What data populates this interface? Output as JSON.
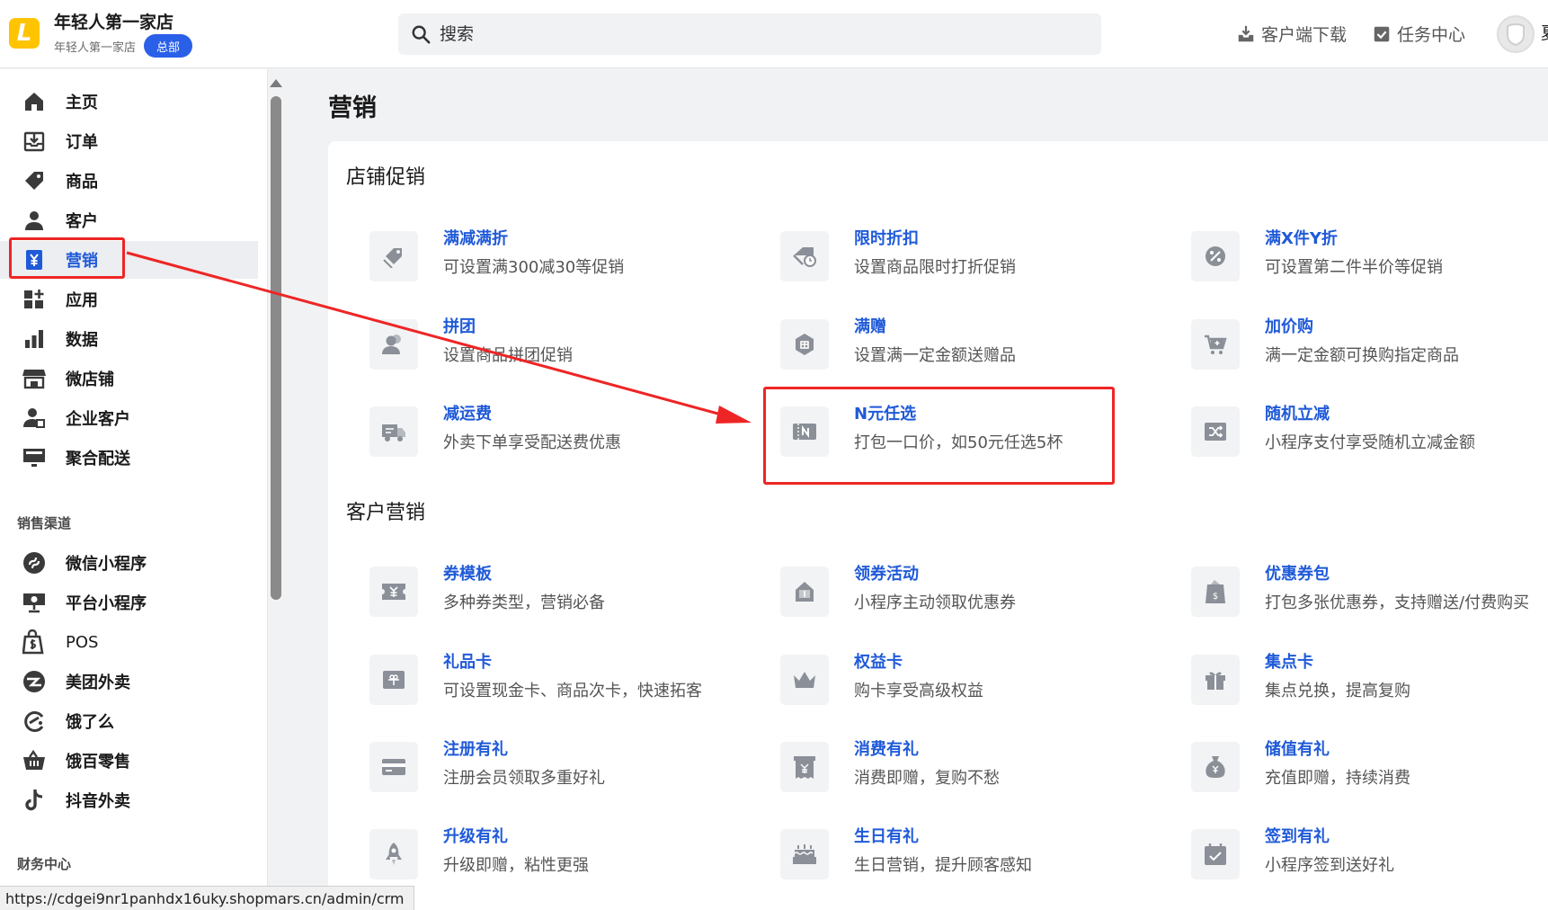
{
  "header": {
    "logo_glyph": "L",
    "store_name": "年轻人第一家店",
    "store_sub": "年轻人第一家店",
    "badge": "总部",
    "search_placeholder": "搜索",
    "client_download": "客户端下载",
    "task_center": "任务中心",
    "cut_text": "夏"
  },
  "sidebar": {
    "main_items": [
      {
        "label": "主页",
        "icon": "home-icon"
      },
      {
        "label": "订单",
        "icon": "order-icon"
      },
      {
        "label": "商品",
        "icon": "tag-icon"
      },
      {
        "label": "客户",
        "icon": "user-icon"
      },
      {
        "label": "营销",
        "icon": "yen-icon",
        "active": true
      },
      {
        "label": "应用",
        "icon": "apps-icon"
      },
      {
        "label": "数据",
        "icon": "bar-chart-icon"
      },
      {
        "label": "微店铺",
        "icon": "store-icon"
      },
      {
        "label": "企业客户",
        "icon": "enterprise-user-icon"
      },
      {
        "label": "聚合配送",
        "icon": "monitor-icon"
      }
    ],
    "channel_title": "销售渠道",
    "channel_items": [
      {
        "label": "微信小程序",
        "icon": "mini-program-icon"
      },
      {
        "label": "平台小程序",
        "icon": "platform-icon"
      },
      {
        "label": "POS",
        "icon": "pos-bag-icon"
      },
      {
        "label": "美团外卖",
        "icon": "meituan-icon"
      },
      {
        "label": "饿了么",
        "icon": "eleme-icon"
      },
      {
        "label": "饿百零售",
        "icon": "basket-icon"
      },
      {
        "label": "抖音外卖",
        "icon": "tiktok-icon"
      }
    ],
    "finance_title": "财务中心"
  },
  "main": {
    "title": "营销",
    "groups": [
      {
        "title": "店铺促销",
        "items": [
          {
            "name": "满减满折",
            "desc": "可设置满300减30等促销",
            "icon": "tag-discount-icon"
          },
          {
            "name": "限时折扣",
            "desc": "设置商品限时打折促销",
            "icon": "timer-tag-icon"
          },
          {
            "name": "满X件Y折",
            "desc": "可设置第二件半价等促销",
            "icon": "percent-icon"
          },
          {
            "name": "拼团",
            "desc": "设置商品拼团促销",
            "icon": "group-icon"
          },
          {
            "name": "满赠",
            "desc": "设置满一定金额送赠品",
            "icon": "gift-badge-icon"
          },
          {
            "name": "加价购",
            "desc": "满一定金额可换购指定商品",
            "icon": "cart-icon"
          },
          {
            "name": "减运费",
            "desc": "外卖下单享受配送费优惠",
            "icon": "delivery-truck-icon"
          },
          {
            "name": "N元任选",
            "desc": "打包一口价，如50元任选5杯",
            "icon": "n-ticket-icon"
          },
          {
            "name": "随机立减",
            "desc": "小程序支付享受随机立减金额",
            "icon": "shuffle-icon"
          }
        ]
      },
      {
        "title": "客户营销",
        "items": [
          {
            "name": "券模板",
            "desc": "多种券类型，营销必备",
            "icon": "coupon-icon"
          },
          {
            "name": "领券活动",
            "desc": "小程序主动领取优惠券",
            "icon": "coupon-bag-icon"
          },
          {
            "name": "优惠券包",
            "desc": "打包多张优惠券，支持赠送/付费购买",
            "icon": "coupon-pack-icon"
          },
          {
            "name": "礼品卡",
            "desc": "可设置现金卡、商品次卡，快速拓客",
            "icon": "gift-card-icon"
          },
          {
            "name": "权益卡",
            "desc": "购卡享受高级权益",
            "icon": "crown-icon"
          },
          {
            "name": "集点卡",
            "desc": "集点兑换，提高复购",
            "icon": "gift-box-icon"
          },
          {
            "name": "注册有礼",
            "desc": "注册会员领取多重好礼",
            "icon": "card-icon"
          },
          {
            "name": "消费有礼",
            "desc": "消费即赠，复购不愁",
            "icon": "receipt-icon"
          },
          {
            "name": "储值有礼",
            "desc": "充值即赠，持续消费",
            "icon": "money-bag-icon"
          },
          {
            "name": "升级有礼",
            "desc": "升级即赠，粘性更强",
            "icon": "rocket-icon"
          },
          {
            "name": "生日有礼",
            "desc": "生日营销，提升顾客感知",
            "icon": "cake-icon"
          },
          {
            "name": "签到有礼",
            "desc": "小程序签到送好礼",
            "icon": "calendar-check-icon"
          }
        ]
      }
    ]
  },
  "status_url": "https://cdgei9nr1panhdx16uky.shopmars.cn/admin/crm",
  "colors": {
    "accent": "#1f5ad8",
    "highlight": "#ee2525",
    "logo": "#ffc400",
    "badge": "#2a5fe8"
  }
}
